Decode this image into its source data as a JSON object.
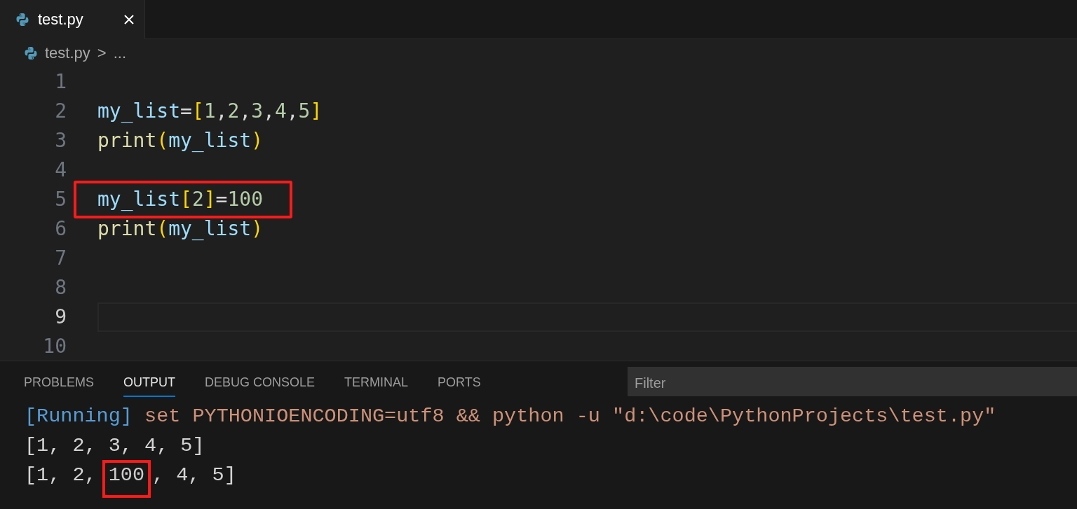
{
  "tabs": [
    {
      "label": "test.py",
      "selected": true
    }
  ],
  "breadcrumb": {
    "file": "test.py",
    "separator": ">",
    "more": "..."
  },
  "editor": {
    "lines": [
      {
        "number": "1",
        "highlighted": false,
        "current": false
      },
      {
        "number": "2",
        "tokens": [
          {
            "text": "my_list",
            "kind": "variable"
          },
          {
            "text": "=",
            "kind": "plain"
          },
          {
            "text": "[",
            "kind": "bracket"
          },
          {
            "text": "1",
            "kind": "number"
          },
          {
            "text": ",",
            "kind": "plain"
          },
          {
            "text": "2",
            "kind": "number"
          },
          {
            "text": ",",
            "kind": "plain"
          },
          {
            "text": "3",
            "kind": "number"
          },
          {
            "text": ",",
            "kind": "plain"
          },
          {
            "text": "4",
            "kind": "number"
          },
          {
            "text": ",",
            "kind": "plain"
          },
          {
            "text": "5",
            "kind": "number"
          },
          {
            "text": "]",
            "kind": "bracket"
          }
        ],
        "highlighted": false,
        "current": false
      },
      {
        "number": "3",
        "tokens": [
          {
            "text": "print",
            "kind": "function"
          },
          {
            "text": "(",
            "kind": "bracket"
          },
          {
            "text": "my_list",
            "kind": "variable"
          },
          {
            "text": ")",
            "kind": "bracket"
          }
        ],
        "highlighted": false,
        "current": false
      },
      {
        "number": "4",
        "highlighted": false,
        "current": false
      },
      {
        "number": "5",
        "tokens": [
          {
            "text": "my_list",
            "kind": "variable"
          },
          {
            "text": "[",
            "kind": "bracket"
          },
          {
            "text": "2",
            "kind": "number"
          },
          {
            "text": "]",
            "kind": "bracket"
          },
          {
            "text": "=",
            "kind": "plain"
          },
          {
            "text": "100",
            "kind": "number"
          }
        ],
        "highlighted": true,
        "current": false
      },
      {
        "number": "6",
        "tokens": [
          {
            "text": "print",
            "kind": "function"
          },
          {
            "text": "(",
            "kind": "bracket"
          },
          {
            "text": "my_list",
            "kind": "variable"
          },
          {
            "text": ")",
            "kind": "bracket"
          }
        ],
        "highlighted": false,
        "current": false
      },
      {
        "number": "7",
        "highlighted": false,
        "current": false
      },
      {
        "number": "8",
        "highlighted": false,
        "current": false
      },
      {
        "number": "9",
        "highlighted": false,
        "current": true
      },
      {
        "number": "10",
        "highlighted": false,
        "current": false
      }
    ]
  },
  "panel": {
    "tabs": [
      {
        "label": "PROBLEMS",
        "selected": false
      },
      {
        "label": "OUTPUT",
        "selected": true
      },
      {
        "label": "DEBUG CONSOLE",
        "selected": false
      },
      {
        "label": "TERMINAL",
        "selected": false
      },
      {
        "label": "PORTS",
        "selected": false
      }
    ],
    "filter": {
      "placeholder": "Filter"
    },
    "output": [
      [
        {
          "text": "[Running]",
          "kind": "status"
        },
        {
          "text": " set PYTHONIOENCODING=utf8 && python -u \"d:\\code\\PythonProjects\\test.py\"",
          "kind": "command"
        }
      ],
      [
        {
          "text": "[1, 2, 3, 4, 5]",
          "kind": "plain"
        }
      ],
      [
        {
          "text": "[1, 2, ",
          "kind": "plain"
        },
        {
          "text": "100",
          "kind": "highlighted"
        },
        {
          "text": ", 4, 5]",
          "kind": "plain"
        }
      ]
    ]
  }
}
